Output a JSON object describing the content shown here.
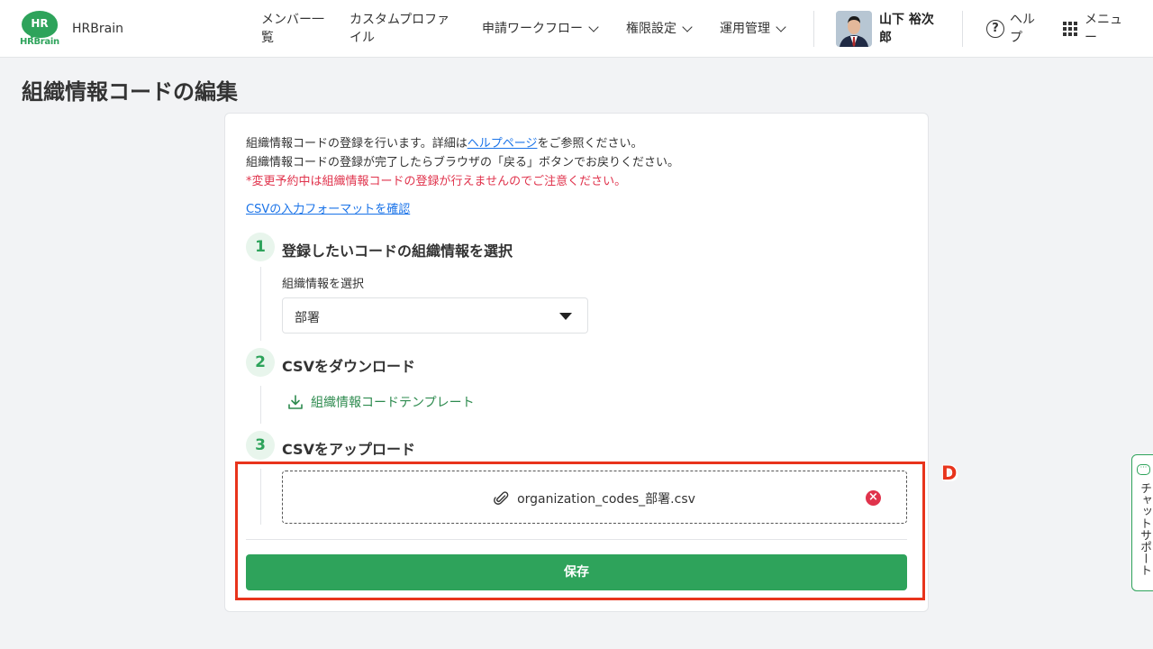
{
  "header": {
    "logo_text": "HR",
    "logo_word": "HRBrain",
    "app_name": "HRBrain",
    "nav": {
      "members_line1": "メンバー一",
      "members_line2": "覧",
      "custom_line1": "カスタムプロファ",
      "custom_line2": "イル",
      "workflow": "申請ワークフロー",
      "permissions": "権限設定",
      "operations": "運用管理"
    },
    "user_name_line1": "山下 裕次",
    "user_name_line2": "郎",
    "help_line1": "ヘル",
    "help_line2": "プ",
    "menu_line1": "メニュ",
    "menu_line2": "ー"
  },
  "page": {
    "title": "組織情報コードの編集"
  },
  "intro": {
    "line1_prefix": "組織情報コードの登録を行います。詳細は",
    "help_link": "ヘルプページ",
    "line1_suffix": "をご参照ください。",
    "line2": "組織情報コードの登録が完了したらブラウザの「戻る」ボタンでお戻りください。",
    "warning": "*変更予約中は組織情報コードの登録が行えませんのでご注意ください。",
    "csv_format_link": "CSVの入力フォーマットを確認"
  },
  "steps": [
    {
      "number": "1",
      "title": "登録したいコードの組織情報を選択"
    },
    {
      "number": "2",
      "title": "CSVをダウンロード"
    },
    {
      "number": "3",
      "title": "CSVをアップロード"
    }
  ],
  "select": {
    "label": "組織情報を選択",
    "value": "部署"
  },
  "download": {
    "label": "組織情報コードテンプレート"
  },
  "upload": {
    "file_name": "organization_codes_部署.csv",
    "remove_symbol": "×"
  },
  "save_label": "保存",
  "annotation": {
    "label": "D",
    "color": "#e8341c"
  },
  "chat": {
    "label": "チャットサポート"
  },
  "colors": {
    "brand_green": "#2ea35b",
    "link_blue": "#1a73e8",
    "warning_red": "#e0334c"
  }
}
